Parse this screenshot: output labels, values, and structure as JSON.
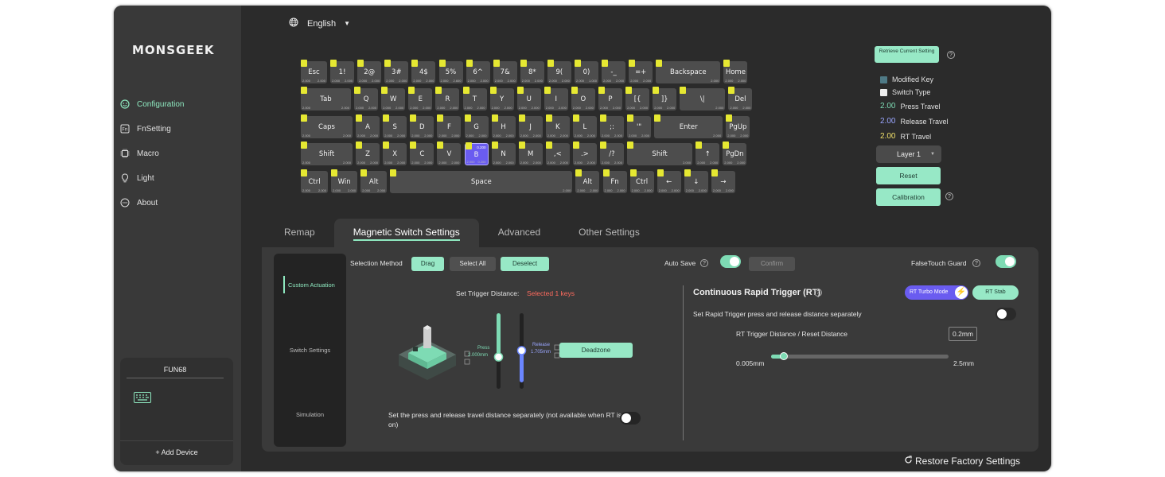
{
  "app": {
    "logo": "MONSGEEK"
  },
  "language": {
    "value": "English"
  },
  "sidebar": {
    "items": [
      {
        "label": "Configuration",
        "icon": "smile-icon",
        "active": true
      },
      {
        "label": "FnSetting",
        "icon": "fn-icon"
      },
      {
        "label": "Macro",
        "icon": "chip-icon"
      },
      {
        "label": "Light",
        "icon": "bulb-icon"
      },
      {
        "label": "About",
        "icon": "dots-icon"
      }
    ],
    "device": {
      "name": "FUN68",
      "add_label": "+ Add Device"
    }
  },
  "keyboard": {
    "rows": [
      [
        {
          "label": "Esc",
          "vals": [
            "2.000",
            "2.000"
          ]
        },
        {
          "label": "1!",
          "vals": [
            "2.000",
            "2.000"
          ]
        },
        {
          "label": "2@",
          "vals": [
            "2.000",
            "2.000"
          ]
        },
        {
          "label": "3#",
          "vals": [
            "2.000",
            "2.000"
          ]
        },
        {
          "label": "4$",
          "vals": [
            "2.000",
            "2.000"
          ]
        },
        {
          "label": "5%",
          "vals": [
            "2.000",
            "2.600"
          ]
        },
        {
          "label": "6^",
          "vals": [
            "2.000",
            "2.000"
          ]
        },
        {
          "label": "7&",
          "vals": [
            "2.000",
            "2.000"
          ]
        },
        {
          "label": "8*",
          "vals": [
            "2.000",
            "2.000"
          ]
        },
        {
          "label": "9(",
          "vals": [
            "2.000",
            "2.000"
          ]
        },
        {
          "label": "0)",
          "vals": [
            "2.000",
            "1.000"
          ]
        },
        {
          "label": "-_",
          "vals": [
            "2.000",
            "2.000"
          ]
        },
        {
          "label": "=+",
          "vals": [
            "2.000",
            "2.000"
          ]
        },
        {
          "label": "Backspace",
          "vals": [
            "",
            "2.000"
          ]
        },
        {
          "label": "Home",
          "vals": [
            "2.000",
            "2.000"
          ]
        }
      ],
      [
        {
          "label": "Tab",
          "vals": [
            "2.000",
            "2.000"
          ]
        },
        {
          "label": "Q",
          "vals": [
            "2.000",
            "2.000"
          ]
        },
        {
          "label": "W",
          "vals": [
            "2.000",
            "2.000"
          ]
        },
        {
          "label": "E",
          "vals": [
            "2.000",
            "2.000"
          ]
        },
        {
          "label": "R",
          "vals": [
            "2.000",
            "2.000"
          ]
        },
        {
          "label": "T",
          "vals": [
            "2.000",
            "2.000"
          ]
        },
        {
          "label": "Y",
          "vals": [
            "2.000",
            "2.000"
          ]
        },
        {
          "label": "U",
          "vals": [
            "2.000",
            "2.000"
          ]
        },
        {
          "label": "I",
          "vals": [
            "2.000",
            "2.000"
          ]
        },
        {
          "label": "O",
          "vals": [
            "2.000",
            "2.000"
          ]
        },
        {
          "label": "P",
          "vals": [
            "2.000",
            "2.000"
          ]
        },
        {
          "label": "[{",
          "vals": [
            "2.000",
            "2.000"
          ]
        },
        {
          "label": "]}",
          "vals": [
            "2.000",
            "2.000"
          ]
        },
        {
          "label": "\\|",
          "vals": [
            "",
            "2.000"
          ]
        },
        {
          "label": "Del",
          "vals": [
            "2.000",
            "2.000"
          ]
        }
      ],
      [
        {
          "label": "Caps",
          "vals": [
            "2.000",
            "2.000"
          ]
        },
        {
          "label": "A",
          "vals": [
            "2.000",
            "2.000"
          ]
        },
        {
          "label": "S",
          "vals": [
            "2.000",
            "2.000"
          ]
        },
        {
          "label": "D",
          "vals": [
            "2.000",
            "2.000"
          ]
        },
        {
          "label": "F",
          "vals": [
            "2.000",
            "2.000"
          ]
        },
        {
          "label": "G",
          "vals": [
            "2.000",
            "2.000"
          ]
        },
        {
          "label": "H",
          "vals": [
            "2.000",
            "2.000"
          ]
        },
        {
          "label": "J",
          "vals": [
            "2.000",
            "2.000"
          ]
        },
        {
          "label": "K",
          "vals": [
            "2.000",
            "2.000"
          ]
        },
        {
          "label": "L",
          "vals": [
            "2.000",
            "2.000"
          ]
        },
        {
          "label": ";:",
          "vals": [
            "2.000",
            "2.000"
          ]
        },
        {
          "label": "'\"",
          "vals": [
            "2.000",
            "2.000"
          ]
        },
        {
          "label": "Enter",
          "vals": [
            "",
            "2.000"
          ]
        },
        {
          "label": "PgUp",
          "vals": [
            "2.000",
            "2.000"
          ]
        }
      ],
      [
        {
          "label": "Shift",
          "vals": [
            "2.000",
            "2.000"
          ]
        },
        {
          "label": "Z",
          "vals": [
            "2.000",
            "2.000"
          ]
        },
        {
          "label": "X",
          "vals": [
            "2.000",
            "2.000"
          ]
        },
        {
          "label": "C",
          "vals": [
            "2.000",
            "2.000"
          ]
        },
        {
          "label": "V",
          "vals": [
            "2.000",
            "2.000"
          ]
        },
        {
          "label": "B",
          "vals": [
            "2.000",
            "0.200"
          ],
          "badge": "0.200",
          "selected": true
        },
        {
          "label": "N",
          "vals": [
            "2.000",
            "2.000"
          ]
        },
        {
          "label": "M",
          "vals": [
            "2.000",
            "2.000"
          ]
        },
        {
          "label": ",<",
          "vals": [
            "2.000",
            "2.000"
          ]
        },
        {
          "label": ".>",
          "vals": [
            "2.000",
            "2.000"
          ]
        },
        {
          "label": "/?",
          "vals": [
            "2.000",
            "2.000"
          ]
        },
        {
          "label": "Shift",
          "vals": [
            "",
            "2.000"
          ]
        },
        {
          "label": "↑",
          "vals": [
            "2.000",
            "2.000"
          ]
        },
        {
          "label": "PgDn",
          "vals": [
            "2.000",
            "2.000"
          ]
        }
      ],
      [
        {
          "label": "Ctrl",
          "vals": [
            "2.000",
            "2.000"
          ]
        },
        {
          "label": "Win",
          "vals": [
            "2.000",
            "2.000"
          ]
        },
        {
          "label": "Alt",
          "vals": [
            "2.000",
            "2.000"
          ]
        },
        {
          "label": "Space",
          "vals": [
            "",
            "2.000"
          ]
        },
        {
          "label": "Alt",
          "vals": [
            "2.000",
            "2.000"
          ]
        },
        {
          "label": "Fn",
          "vals": [
            "2.000",
            "2.000"
          ]
        },
        {
          "label": "Ctrl",
          "vals": [
            "2.000",
            "2.000"
          ]
        },
        {
          "label": "←",
          "vals": [
            "2.000",
            "2.000"
          ]
        },
        {
          "label": "↓",
          "vals": [
            "2.000",
            "2.000"
          ]
        },
        {
          "label": "→",
          "vals": [
            "2.000",
            "2.000"
          ]
        }
      ]
    ]
  },
  "right_panel": {
    "retrieve_label": "Retrieve Current Setting",
    "legend": {
      "modified_key": "Modified Key",
      "switch_type": "Switch Type",
      "press": {
        "value": "2.00",
        "label": "Press Travel",
        "color": "#7edbb4"
      },
      "release": {
        "value": "2.00",
        "label": "Release Travel",
        "color": "#9aa6ff"
      },
      "rt": {
        "value": "2.00",
        "label": "RT Travel",
        "color": "#f0e06a"
      }
    },
    "layer": "Layer 1",
    "reset_label": "Reset",
    "calibration_label": "Calibration"
  },
  "tabs": [
    "Remap",
    "Magnetic Switch Settings",
    "Advanced",
    "Other Settings"
  ],
  "panel": {
    "subnav": [
      "Custom Actuation",
      "Switch Settings",
      "Simulation"
    ],
    "selection_method_label": "Selection Method",
    "drag_label": "Drag",
    "select_all_label": "Select All",
    "deselect_label": "Deselect",
    "auto_save_label": "Auto Save",
    "confirm_label": "Confirm",
    "false_touch_label": "FalseTouch Guard",
    "trigger_label": "Set Trigger Distance:",
    "selected_keys": "Selected 1 keys",
    "press_label": "Press",
    "press_value": "2.000mm",
    "release_label": "Release",
    "release_value": "1.705mm",
    "deadzone_label": "Deadzone",
    "separate_text": "Set the press and release travel distance separately (not available when RT is on)",
    "rt_title": "Continuous Rapid Trigger (RT)",
    "rt_turbo_label": "RT Turbo Mode",
    "rt_stab_label": "RT Stab",
    "rt_separate_label": "Set Rapid Trigger press and release distance separately",
    "rt_distance_label": "RT Trigger Distance / Reset Distance",
    "rt_distance_value": "0.2mm",
    "rt_min": "0.005mm",
    "rt_max": "2.5mm"
  },
  "restore_label": "Restore Factory Settings"
}
